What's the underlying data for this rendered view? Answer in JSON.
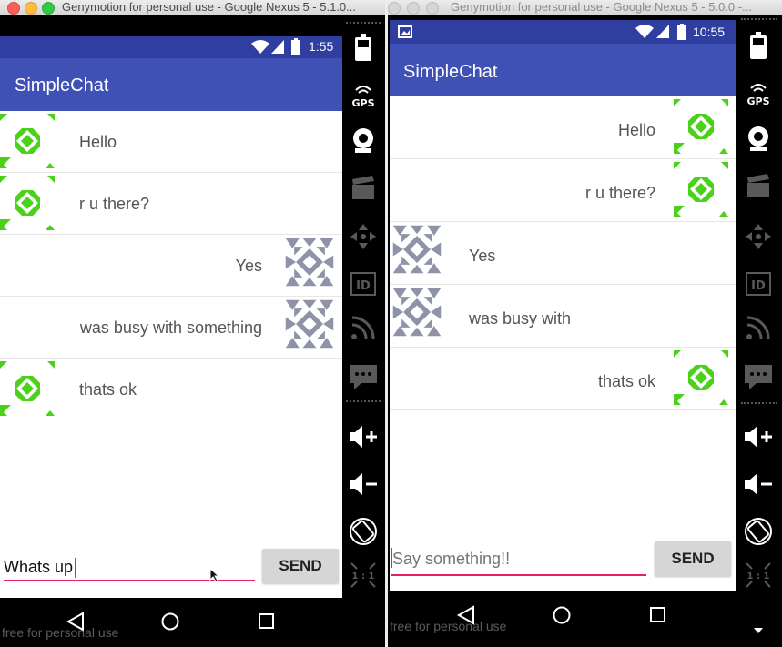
{
  "colors": {
    "status_bar": "#303f9f",
    "app_bar": "#3f51b5",
    "accent_pink": "#e91e63",
    "identicon_green": "#4bd11a",
    "identicon_gray": "#8f93a8"
  },
  "window_left": {
    "title": "Genymotion for personal use - Google Nexus 5 - 5.1.0...",
    "clock": "1:55",
    "app_title": "SimpleChat",
    "messages": [
      {
        "text": "Hello",
        "avatar_icon": "green-identicon"
      },
      {
        "text": "r u there?",
        "avatar_icon": "green-identicon"
      },
      {
        "text": "Yes",
        "avatar_icon": "gray-identicon"
      },
      {
        "text": "was busy with something",
        "avatar_icon": "gray-identicon"
      },
      {
        "text": "thats ok",
        "avatar_icon": "green-identicon"
      }
    ],
    "input_value": "Whats up",
    "send_label": "SEND",
    "watermark": "free for personal use"
  },
  "window_right": {
    "title": "Genymotion for personal use - Google Nexus 5 - 5.0.0 -...",
    "clock": "10:55",
    "app_title": "SimpleChat",
    "messages": [
      {
        "text": "Hello",
        "avatar_icon": "green-identicon"
      },
      {
        "text": "r u there?",
        "avatar_icon": "green-identicon"
      },
      {
        "text": "Yes",
        "avatar_icon": "gray-identicon"
      },
      {
        "text": "was busy with",
        "avatar_icon": "gray-identicon"
      },
      {
        "text": "thats ok",
        "avatar_icon": "green-identicon"
      }
    ],
    "input_placeholder": "Say something!!",
    "send_label": "SEND",
    "watermark": "free for personal use"
  },
  "emulator_tools": [
    "battery-icon",
    "gps-icon",
    "webcam-icon",
    "clapper-icon",
    "dpad-icon",
    "id-icon",
    "rss-icon",
    "sms-icon",
    "volume-up-icon",
    "volume-down-icon",
    "rotate-icon",
    "scale-icon"
  ],
  "emulator_tool_labels": {
    "gps": "GPS",
    "id": "ID",
    "scale": "1 : 1"
  }
}
